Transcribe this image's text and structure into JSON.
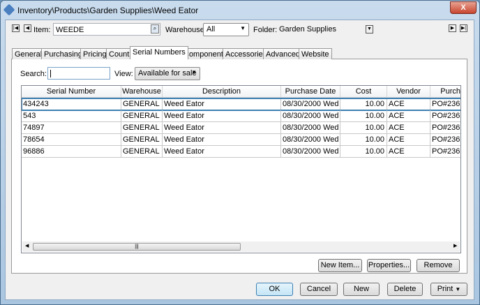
{
  "window": {
    "title": "Inventory\\Products\\Garden Supplies\\Weed Eator",
    "close": "X"
  },
  "toolbar": {
    "item_label": "Item:",
    "item_value": "WEEDE",
    "warehouse_label": "Warehouse:",
    "warehouse_value": "All",
    "folder_label": "Folder:",
    "folder_value": "Garden Supplies"
  },
  "tabs": [
    "General",
    "Purchasing",
    "Pricing",
    "Count",
    "Serial Numbers",
    "Components",
    "Accessories",
    "Advanced",
    "Website"
  ],
  "active_tab": "Serial Numbers",
  "filter": {
    "search_label": "Search:",
    "search_value": "",
    "view_label": "View:",
    "view_value": "Available for sale"
  },
  "grid": {
    "columns": [
      "Serial Number",
      "Warehouse",
      "Description",
      "Purchase Date",
      "Cost",
      "Vendor",
      "Purch"
    ],
    "rows": [
      [
        "434243",
        "GENERAL",
        "Weed Eator",
        "08/30/2000 Wed",
        "10.00",
        "ACE",
        "PO#236"
      ],
      [
        "543",
        "GENERAL",
        "Weed Eator",
        "08/30/2000 Wed",
        "10.00",
        "ACE",
        "PO#236"
      ],
      [
        "74897",
        "GENERAL",
        "Weed Eator",
        "08/30/2000 Wed",
        "10.00",
        "ACE",
        "PO#236"
      ],
      [
        "78654",
        "GENERAL",
        "Weed Eator",
        "08/30/2000 Wed",
        "10.00",
        "ACE",
        "PO#236"
      ],
      [
        "96886",
        "GENERAL",
        "Weed Eator",
        "08/30/2000 Wed",
        "10.00",
        "ACE",
        "PO#236"
      ]
    ]
  },
  "panel_buttons": {
    "new_item": "New Item...",
    "properties": "Properties...",
    "remove": "Remove"
  },
  "buttons": {
    "ok": "OK",
    "cancel": "Cancel",
    "new": "New",
    "delete": "Delete",
    "print": "Print"
  }
}
